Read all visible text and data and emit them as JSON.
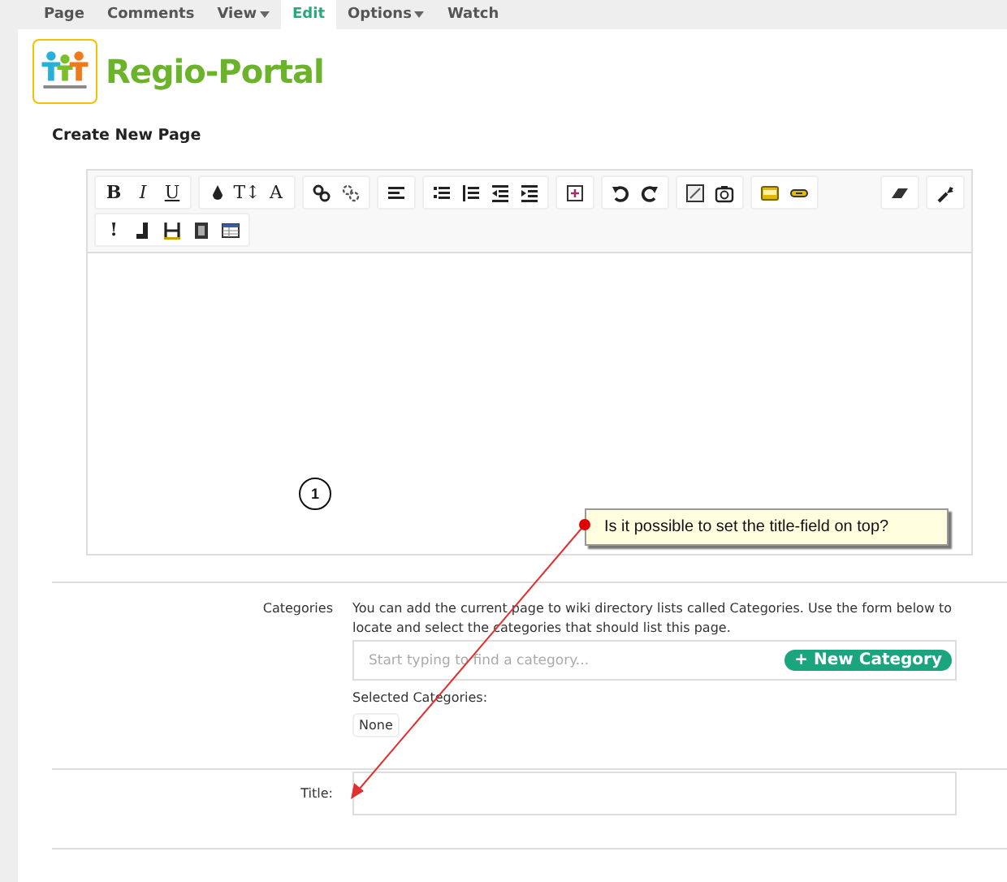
{
  "nav_tabs": [
    {
      "label": "Page",
      "selected": false,
      "dropdown": false
    },
    {
      "label": "Comments",
      "selected": false,
      "dropdown": false
    },
    {
      "label": "View",
      "selected": false,
      "dropdown": true
    },
    {
      "label": "Edit",
      "selected": true,
      "dropdown": false
    },
    {
      "label": "Options",
      "selected": false,
      "dropdown": true
    },
    {
      "label": "Watch",
      "selected": false,
      "dropdown": false
    }
  ],
  "site": {
    "title": "Regio-Portal"
  },
  "heading": "Create New Page",
  "editor": {
    "toolbar_rows": [
      {
        "groups": [
          [
            {
              "kind": "text",
              "label": "B"
            },
            {
              "kind": "text",
              "label": "I"
            },
            {
              "kind": "text",
              "label": "U"
            }
          ],
          [
            {
              "kind": "icon"
            },
            {
              "kind": "text",
              "label": "T↕"
            },
            {
              "kind": "text",
              "label": "A"
            }
          ],
          [
            {
              "kind": "icon"
            },
            {
              "kind": "icon"
            }
          ],
          [
            {
              "kind": "icon"
            }
          ],
          [
            {
              "kind": "icon"
            },
            {
              "kind": "icon"
            },
            {
              "kind": "icon"
            },
            {
              "kind": "icon"
            }
          ],
          [
            {
              "kind": "icon"
            }
          ],
          [
            {
              "kind": "icon"
            },
            {
              "kind": "icon"
            }
          ],
          [
            {
              "kind": "icon"
            },
            {
              "kind": "icon"
            }
          ],
          [
            {
              "kind": "icon"
            },
            {
              "kind": "icon"
            }
          ]
        ],
        "right_groups": [
          [
            {
              "kind": "icon"
            }
          ],
          [
            {
              "kind": "icon"
            }
          ]
        ]
      },
      {
        "groups": [
          [
            {
              "kind": "text",
              "label": "!"
            },
            {
              "kind": "icon"
            },
            {
              "kind": "icon"
            },
            {
              "kind": "icon"
            },
            {
              "kind": "icon"
            }
          ]
        ],
        "right_groups": []
      }
    ]
  },
  "categories": {
    "label": "Categories",
    "help": "You can add the current page to wiki directory lists called Categories. Use the form below to locate and select the categories that should list this page.",
    "placeholder": "Start typing to find a category...",
    "new_button": "+ New Category",
    "selected_label": "Selected Categories:",
    "selected_value": "None"
  },
  "title_field": {
    "label": "Title:"
  },
  "annotation": {
    "number": "1",
    "note": "Is it possible to set the title-field on top?"
  }
}
